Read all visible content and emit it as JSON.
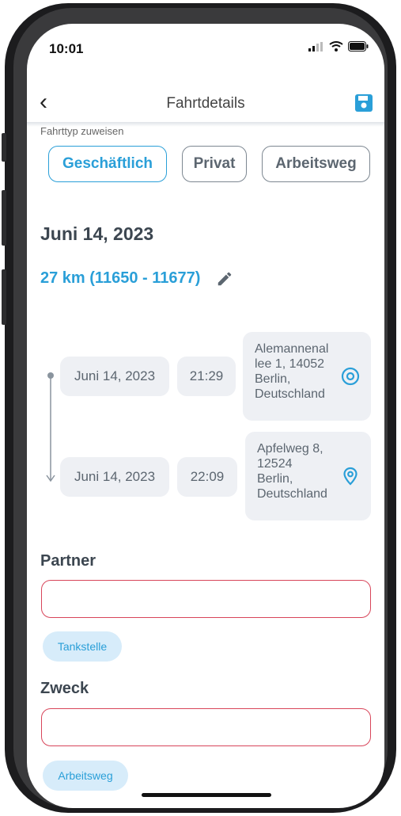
{
  "status_bar": {
    "time": "10:01"
  },
  "nav": {
    "title": "Fahrtdetails"
  },
  "trip_type": {
    "label": "Fahrttyp zuweisen",
    "options": [
      "Geschäftlich",
      "Privat",
      "Arbeitsweg"
    ],
    "selected": "Geschäftlich"
  },
  "trip": {
    "date": "Juni 14, 2023",
    "distance": "27 km (11650 - 11677)",
    "start": {
      "date": "Juni 14, 2023",
      "time": "21:29",
      "address": "Alemannenal\nlee 1, 14052\nBerlin,\nDeutschland"
    },
    "end": {
      "date": "Juni 14, 2023",
      "time": "22:09",
      "address": "Apfelweg 8,\n12524\nBerlin,\nDeutschland"
    }
  },
  "partner": {
    "label": "Partner",
    "value": "",
    "suggestion": "Tankstelle"
  },
  "purpose": {
    "label": "Zweck",
    "value": "",
    "suggestion": "Arbeitsweg"
  },
  "colors": {
    "accent": "#2a9fd8",
    "error": "#d8455a",
    "chip_bg": "#eef0f4"
  }
}
